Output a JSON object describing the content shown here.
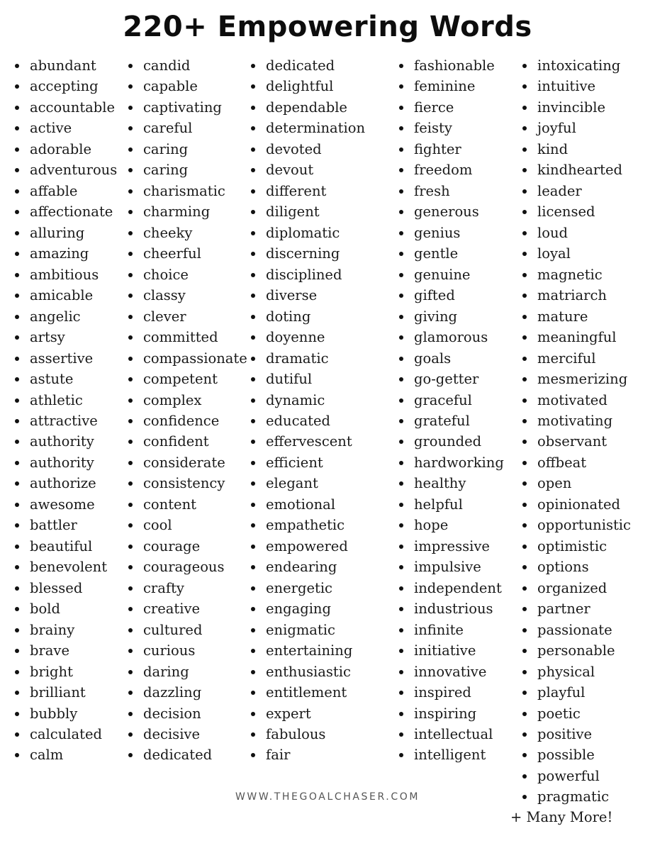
{
  "title": "220+ Empowering Words",
  "columns": [
    {
      "words": [
        "abundant",
        "accepting",
        "accountable",
        "active",
        "adorable",
        "adventurous",
        "affable",
        "affectionate",
        "alluring",
        "amazing",
        "ambitious",
        "amicable",
        "angelic",
        "artsy",
        "assertive",
        "astute",
        "athletic",
        "attractive",
        "authority",
        "authority",
        "authorize",
        "awesome",
        "battler",
        "beautiful",
        "benevolent",
        "blessed",
        "bold",
        "brainy",
        "brave",
        "bright",
        "brilliant",
        "bubbly",
        "calculated",
        "calm"
      ]
    },
    {
      "words": [
        "candid",
        "capable",
        "captivating",
        "careful",
        "caring",
        "caring",
        "charismatic",
        "charming",
        "cheeky",
        "cheerful",
        "choice",
        "classy",
        "clever",
        "committed",
        "compassionate",
        "competent",
        "complex",
        "confidence",
        "confident",
        "considerate",
        "consistency",
        "content",
        "cool",
        "courage",
        "courageous",
        "crafty",
        "creative",
        "cultured",
        "curious",
        "daring",
        "dazzling",
        "decision",
        "decisive",
        "dedicated"
      ]
    },
    {
      "words": [
        "dedicated",
        "delightful",
        "dependable",
        "determination",
        "devoted",
        "devout",
        "different",
        "diligent",
        "diplomatic",
        "discerning",
        "disciplined",
        "diverse",
        "doting",
        "doyenne",
        "dramatic",
        "dutiful",
        "dynamic",
        "educated",
        "effervescent",
        "efficient",
        "elegant",
        "emotional",
        "empathetic",
        "empowered",
        "endearing",
        "energetic",
        "engaging",
        "enigmatic",
        "entertaining",
        "enthusiastic",
        "entitlement",
        "expert",
        "fabulous",
        "fair"
      ]
    },
    {
      "words": [
        "fashionable",
        "feminine",
        "fierce",
        "feisty",
        "fighter",
        "freedom",
        "fresh",
        "generous",
        "genius",
        "gentle",
        "genuine",
        "gifted",
        "giving",
        "glamorous",
        "goals",
        "go-getter",
        "graceful",
        "grateful",
        "grounded",
        "hardworking",
        "healthy",
        "helpful",
        "hope",
        "impressive",
        "impulsive",
        "independent",
        "industrious",
        "infinite",
        "initiative",
        "innovative",
        "inspired",
        "inspiring",
        "intellectual",
        "intelligent"
      ]
    },
    {
      "words": [
        "intoxicating",
        "intuitive",
        "invincible",
        "joyful",
        "kind",
        "kindhearted",
        "leader",
        "licensed",
        "loud",
        "loyal",
        "magnetic",
        "matriarch",
        "mature",
        "meaningful",
        "merciful",
        "mesmerizing",
        "motivated",
        "motivating",
        "observant",
        "offbeat",
        "open",
        "opinionated",
        "opportunistic",
        "optimistic",
        "options",
        "organized",
        "partner",
        "passionate",
        "personable",
        "physical",
        "playful",
        "poetic",
        "positive",
        "possible",
        "powerful",
        "pragmatic"
      ]
    }
  ],
  "more_label": "+ Many More!",
  "footer": "WWW.THEGOALCHASER.COM",
  "colors": {
    "text": "#1a1a1a",
    "title": "#0d0d0d",
    "footer": "#555555",
    "background": "#ffffff"
  }
}
